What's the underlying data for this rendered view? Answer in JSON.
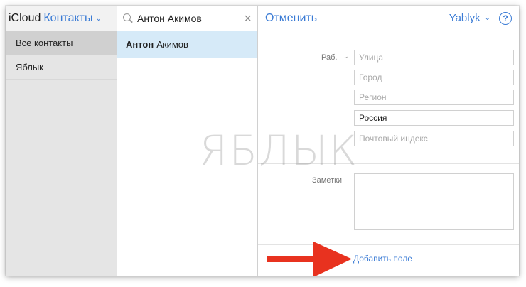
{
  "sidebar": {
    "app_name": "iCloud",
    "section": "Контакты",
    "groups": [
      {
        "label": "Все контакты"
      },
      {
        "label": "Яблык"
      }
    ]
  },
  "list": {
    "search": {
      "value": "Антон Акимов"
    },
    "contacts": [
      {
        "first": "Антон",
        "last": "Акимов"
      }
    ]
  },
  "detail": {
    "cancel_label": "Отменить",
    "account_label": "Yablyk",
    "help_label": "?",
    "address_label": "Раб.",
    "address_fields": {
      "street_placeholder": "Улица",
      "city_placeholder": "Город",
      "region_placeholder": "Регион",
      "country_value": "Россия",
      "zip_placeholder": "Почтовый индекс"
    },
    "notes_label": "Заметки",
    "add_field_label": "Добавить поле"
  },
  "watermark": "ЯБЛЫК",
  "colors": {
    "accent": "#3a7bd5",
    "selected_row": "#d6eaf8",
    "arrow": "#e8321f"
  }
}
